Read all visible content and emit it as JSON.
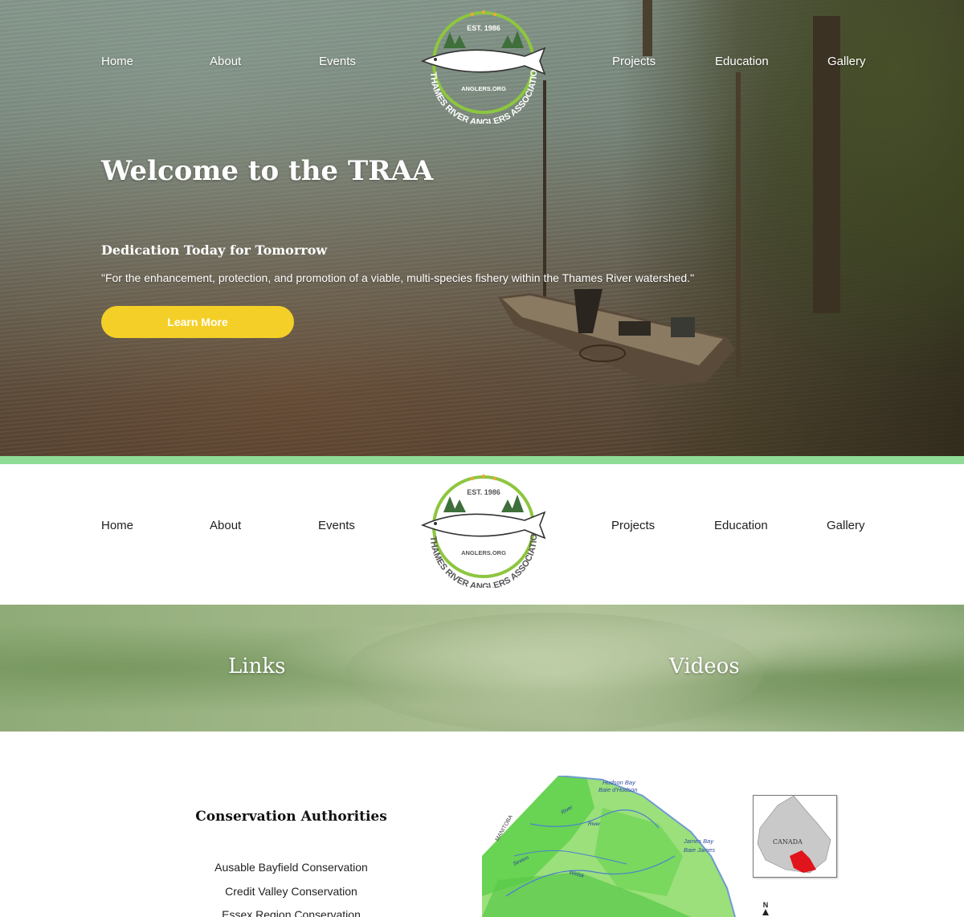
{
  "nav": {
    "items": [
      "Home",
      "About",
      "Events",
      "Projects",
      "Education",
      "Gallery"
    ]
  },
  "logo": {
    "est": "EST. 1986",
    "site": "ANGLERS.ORG",
    "ring_text": "THAMES RIVER ANGLERS ASSOCIATION",
    "colors": {
      "ring": "#8dc63f",
      "trees": "#3f6f3a",
      "dots": "#e8a93a",
      "text": "#555555"
    }
  },
  "hero": {
    "title": "Welcome to the TRAA",
    "subtitle": "Dedication Today for Tomorrow",
    "quote": "\"For the enhancement, protection, and promotion of a viable, multi-species fishery within the Thames River watershed.\"",
    "button_label": "Learn More",
    "button_color": "#f4cf27"
  },
  "accent_bar_color": "#8fdc97",
  "banner": {
    "links_label": "Links",
    "videos_label": "Videos"
  },
  "conservation": {
    "title": "Conservation Authorities",
    "items": [
      "Ausable Bayfield Conservation",
      "Credit Valley Conservation",
      "Essex Region Conservation"
    ]
  },
  "map": {
    "labels": {
      "hudson_bay": "Hudson Bay",
      "baie_hudson": "Baie d'Hudson",
      "manitoba": "MANITOBA",
      "james_bay": "James Bay",
      "baie_james": "Baie James",
      "canada": "CANADA",
      "river": "River",
      "severn": "Severn",
      "winisk": "Winisk",
      "north": "N"
    },
    "highlight_color": "#e0141b"
  }
}
